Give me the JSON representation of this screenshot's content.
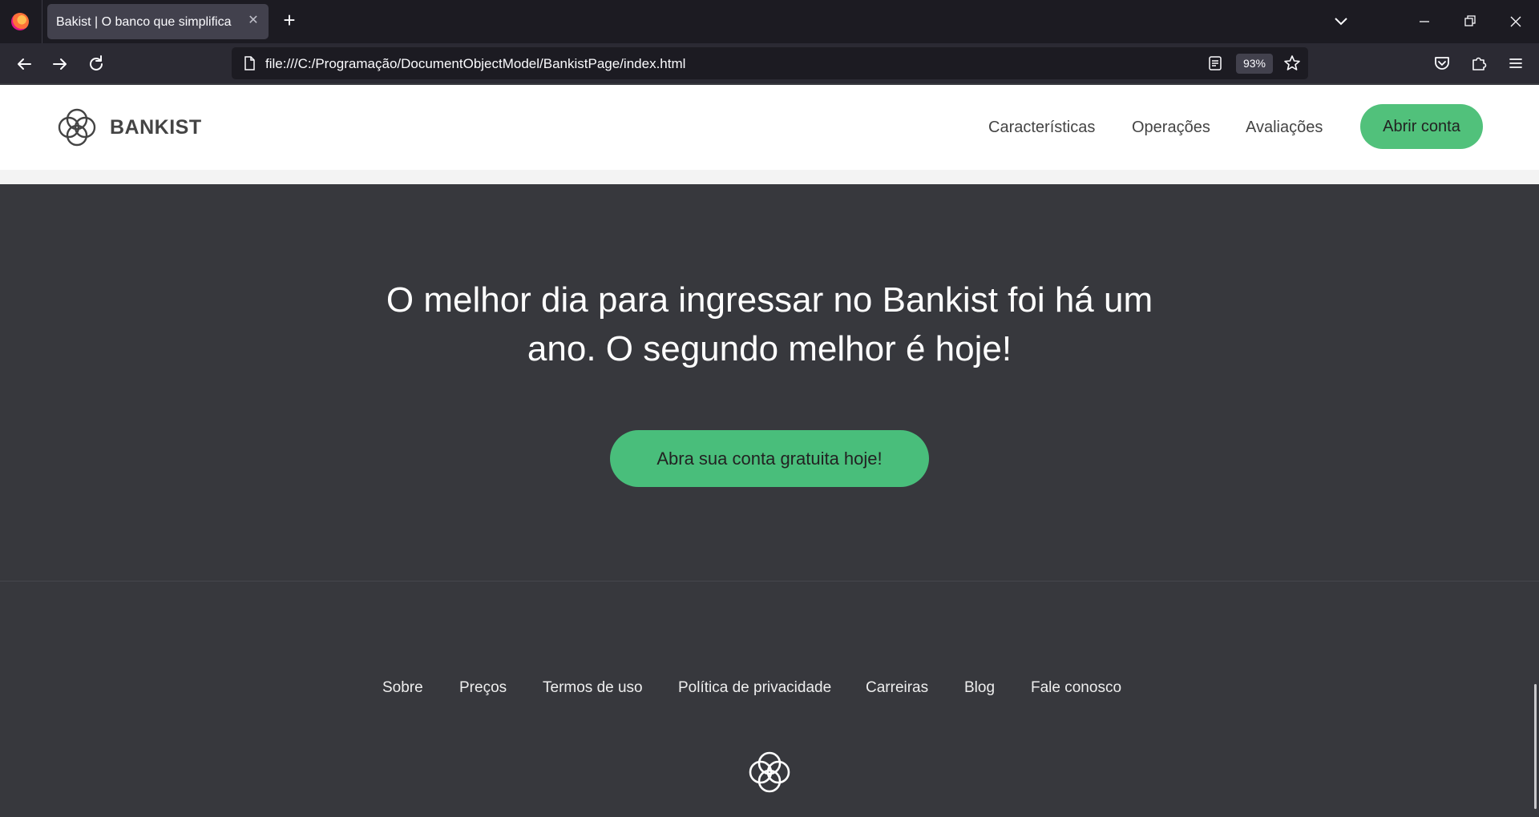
{
  "browser": {
    "tab_title": "Bakist | O banco que simplifica",
    "tab_close_glyph": "✕",
    "new_tab_glyph": "+",
    "url": "file:///C:/Programação/DocumentObjectModel/BankistPage/index.html",
    "zoom": "93%"
  },
  "header": {
    "logo_text": "BANKIST",
    "nav": [
      "Características",
      "Operações",
      "Avaliações"
    ],
    "open_account": "Abrir conta"
  },
  "cta": {
    "title": "O melhor dia para ingressar no Bankist foi há um ano. O segundo melhor é hoje!",
    "button": "Abra sua conta gratuita hoje!"
  },
  "footer": {
    "links": [
      "Sobre",
      "Preços",
      "Termos de uso",
      "Política de privacidade",
      "Carreiras",
      "Blog",
      "Fale conosco"
    ]
  },
  "colors": {
    "accent_green": "#51c17b",
    "section_dark": "#37383d",
    "chrome_dark": "#1c1b22"
  }
}
